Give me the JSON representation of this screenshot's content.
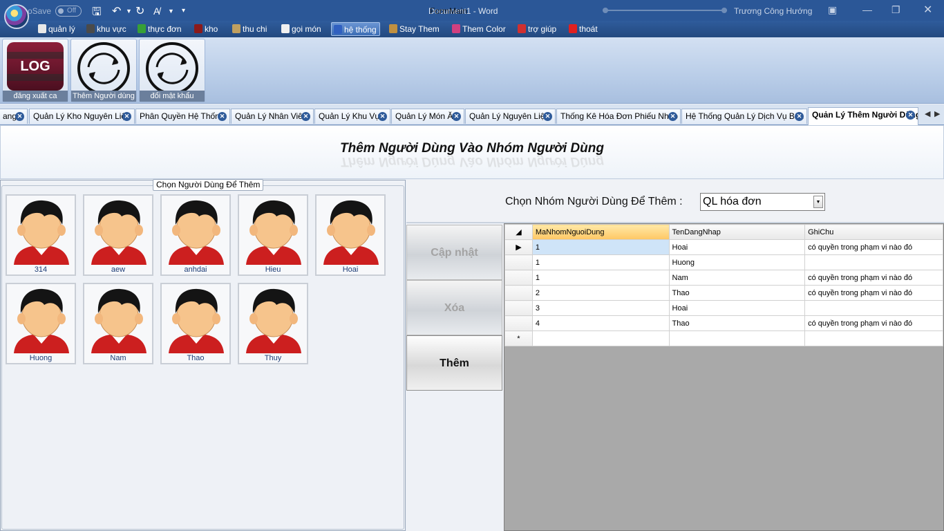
{
  "titlebar": {
    "autosave_label": "oSave",
    "autosave_toggle": "Off",
    "doc_title": "Document1 - Word",
    "form_overlay": "FormMain",
    "user": "Trương Công Hướng"
  },
  "menu": [
    {
      "label": "quản lý",
      "icon": "manage-icon",
      "color": "#e8e8e8"
    },
    {
      "label": "khu vực",
      "icon": "area-icon",
      "color": "#4a4a4a"
    },
    {
      "label": "thực đơn",
      "icon": "menu-book-icon",
      "color": "#37a036"
    },
    {
      "label": "kho",
      "icon": "warehouse-icon",
      "color": "#8b1a1a"
    },
    {
      "label": "thu chi",
      "icon": "money-icon",
      "color": "#c0a060"
    },
    {
      "label": "gọi món",
      "icon": "order-icon",
      "color": "#f0f0f0"
    },
    {
      "label": "hệ thống",
      "icon": "system-tools-icon",
      "color": "#3060c0",
      "active": true
    },
    {
      "label": "Stay Them",
      "icon": "style-icon",
      "color": "#c09040"
    },
    {
      "label": "Them Color",
      "icon": "palette-icon",
      "color": "#d04080"
    },
    {
      "label": "trợ giúp",
      "icon": "help-icon",
      "color": "#d03030"
    },
    {
      "label": "thoát",
      "icon": "exit-icon",
      "color": "#e02020"
    }
  ],
  "ribbon": {
    "logout_label": "đăng xuất ca",
    "logout_icon_text": "LOG",
    "add_user_label": "Thêm Người dùng",
    "change_password_label": "đổi mật khẩu"
  },
  "tabs": [
    {
      "label": "ang"
    },
    {
      "label": "Quản Lý Kho Nguyên Liệu"
    },
    {
      "label": "Phân Quyền Hệ Thống"
    },
    {
      "label": "Quản Lý Nhân Viên"
    },
    {
      "label": "Quản Lý Khu Vực"
    },
    {
      "label": "Quản Lý Món Ăn"
    },
    {
      "label": "Quản Lý Nguyên Liệu"
    },
    {
      "label": "Thống Kê Hóa Đơn Phiếu Nhập"
    },
    {
      "label": "Hệ Thống Quản Lý Dịch Vụ Bàn"
    },
    {
      "label": "Quản Lý Thêm Người Dùng",
      "active": true
    }
  ],
  "page": {
    "title": "Thêm Người Dùng Vào Nhóm Người Dùng",
    "user_group_legend": "Chọn Người Dùng Để Thêm",
    "group_select_label": "Chọn Nhóm Người Dùng Để Thêm :",
    "group_select_value": "QL hóa đơn"
  },
  "users": [
    "314",
    "aew",
    "anhdai",
    "Hieu",
    "Hoai",
    "Huong",
    "Nam",
    "Thao",
    "Thuy"
  ],
  "actions": {
    "update": "Cập nhật",
    "delete": "Xóa",
    "add": "Thêm"
  },
  "grid": {
    "columns": [
      "MaNhomNguoiDung",
      "TenDangNhap",
      "GhiChu"
    ],
    "rows": [
      [
        "1",
        "Hoai",
        "có quyền trong phạm vi nào đó"
      ],
      [
        "1",
        "Huong",
        ""
      ],
      [
        "1",
        "Nam",
        "có quyền trong phạm vi nào đó"
      ],
      [
        "2",
        "Thao",
        "có quyền trong phạm vi nào đó"
      ],
      [
        "3",
        "Hoai",
        ""
      ],
      [
        "4",
        "Thao",
        "có quyền trong phạm vi nào đó"
      ]
    ],
    "current_row_marker": "▶",
    "new_row_marker": "*"
  }
}
